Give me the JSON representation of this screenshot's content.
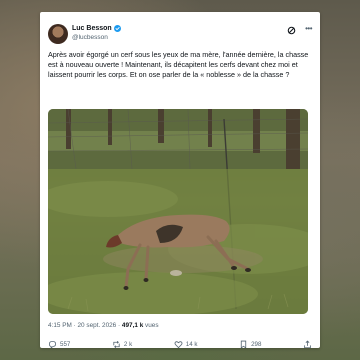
{
  "tweet": {
    "author_name": "Luc Besson",
    "handle": "@lucbesson",
    "text": "Après avoir égorgé un cerf sous les yeux de ma mère, l'année dernière, la chasse est à nouveau ouverte ! Maintenant, ils décapitent les cerfs devant chez moi et laissent pourrir les corps. Et on ose parler de la « noblesse » de la chasse ?",
    "time": "4:15 PM",
    "date": "20 sept. 2026",
    "views_count": "497,1 k",
    "views_label": "vues",
    "separator": " · "
  },
  "actions": {
    "replies": "557",
    "reposts": "2 k",
    "likes": "14 k",
    "bookmarks": "298"
  },
  "colors": {
    "verified": "#1d9bf0",
    "text": "#0f1419",
    "muted": "#536471"
  }
}
